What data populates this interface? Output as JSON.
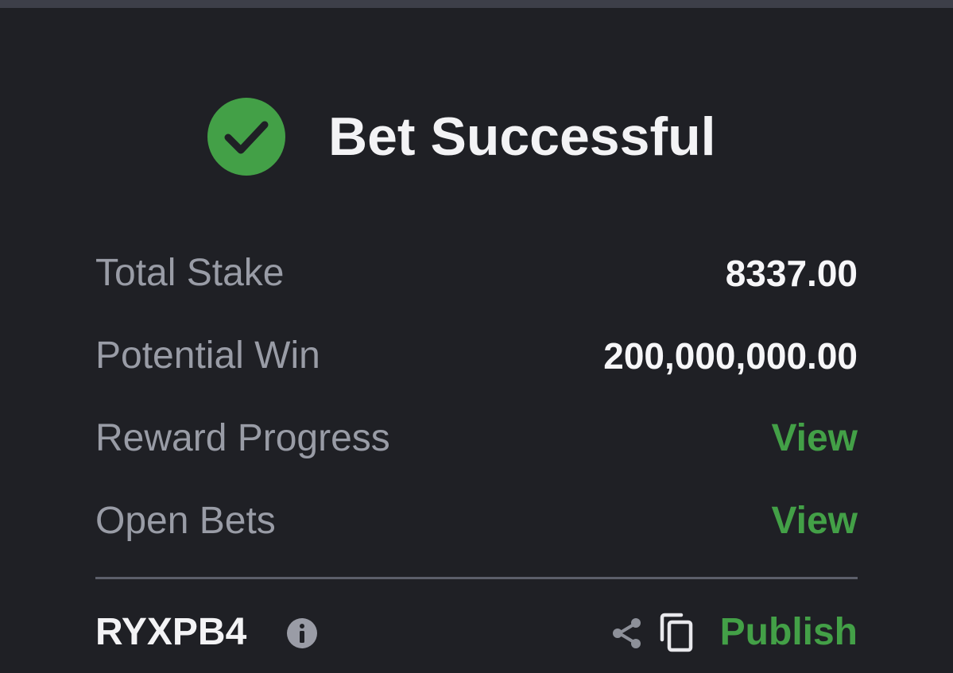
{
  "header": {
    "title": "Bet Successful",
    "status_icon": "check-circle-icon",
    "status_color": "#43a047"
  },
  "summary": {
    "total_stake": {
      "label": "Total Stake",
      "value": "8337.00"
    },
    "potential_win": {
      "label": "Potential Win",
      "value": "200,000,000.00"
    },
    "reward_progress": {
      "label": "Reward Progress",
      "link": "View"
    },
    "open_bets": {
      "label": "Open Bets",
      "link": "View"
    }
  },
  "footer": {
    "booking_code": "RYXPB4",
    "info_icon": "info-icon",
    "share_icon": "share-icon",
    "copy_icon": "copy-icon",
    "publish_label": "Publish"
  },
  "colors": {
    "background": "#1f2025",
    "accent": "#43a047",
    "label": "#999ca6",
    "value": "#f6f6f8"
  }
}
